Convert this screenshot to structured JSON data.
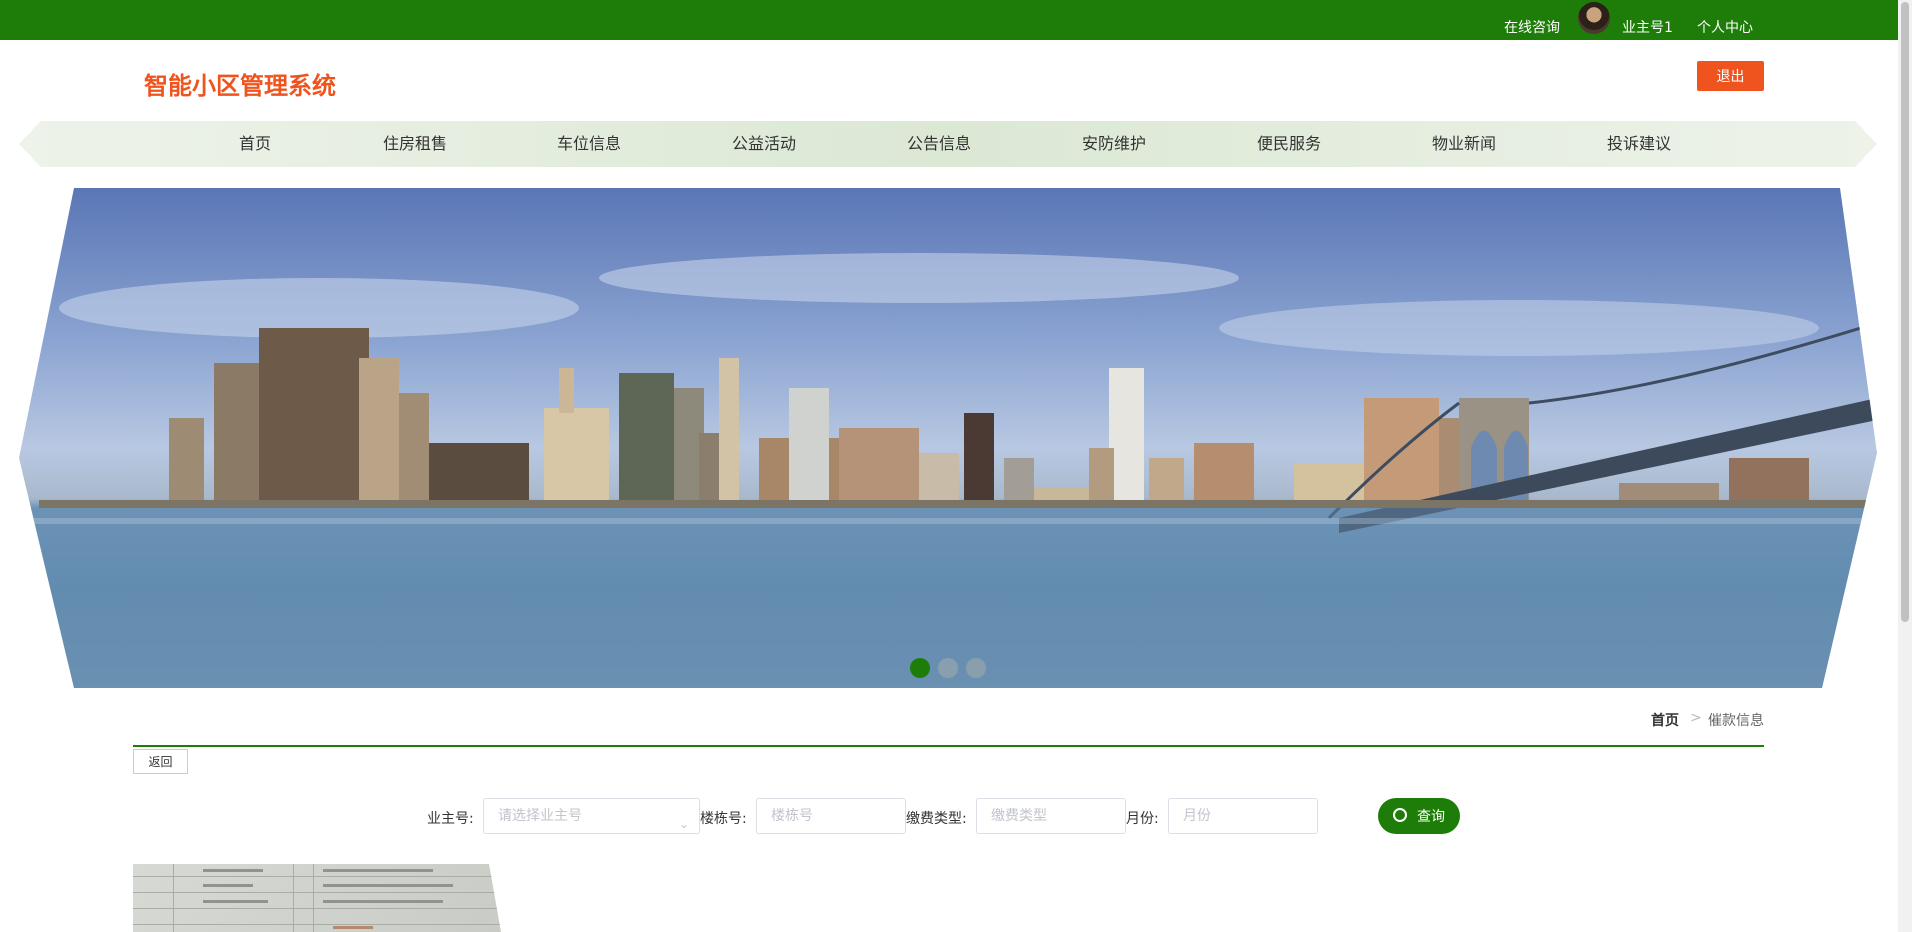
{
  "topbar": {
    "consult": "在线咨询",
    "username": "业主号1",
    "personal_center": "个人中心"
  },
  "header": {
    "logo": "智能小区管理系统",
    "logout": "退出"
  },
  "nav": {
    "items": [
      {
        "label": "首页"
      },
      {
        "label": "住房租售"
      },
      {
        "label": "车位信息"
      },
      {
        "label": "公益活动"
      },
      {
        "label": "公告信息"
      },
      {
        "label": "安防维护"
      },
      {
        "label": "便民服务"
      },
      {
        "label": "物业新闻"
      },
      {
        "label": "投诉建议"
      }
    ]
  },
  "banner": {
    "slide_count": 3,
    "active_slide": 1
  },
  "breadcrumb": {
    "home": "首页",
    "separator": ">",
    "current": "催款信息"
  },
  "back_label": "返回",
  "search": {
    "owner_label": "业主号:",
    "owner_placeholder": "请选择业主号",
    "building_label": "楼栋号:",
    "building_placeholder": "楼栋号",
    "fee_type_label": "缴费类型:",
    "fee_type_placeholder": "缴费类型",
    "month_label": "月份:",
    "month_placeholder": "月份",
    "query_button": "查询"
  },
  "colors": {
    "primary_green": "#1e7d09",
    "accent_orange": "#f0541e"
  }
}
